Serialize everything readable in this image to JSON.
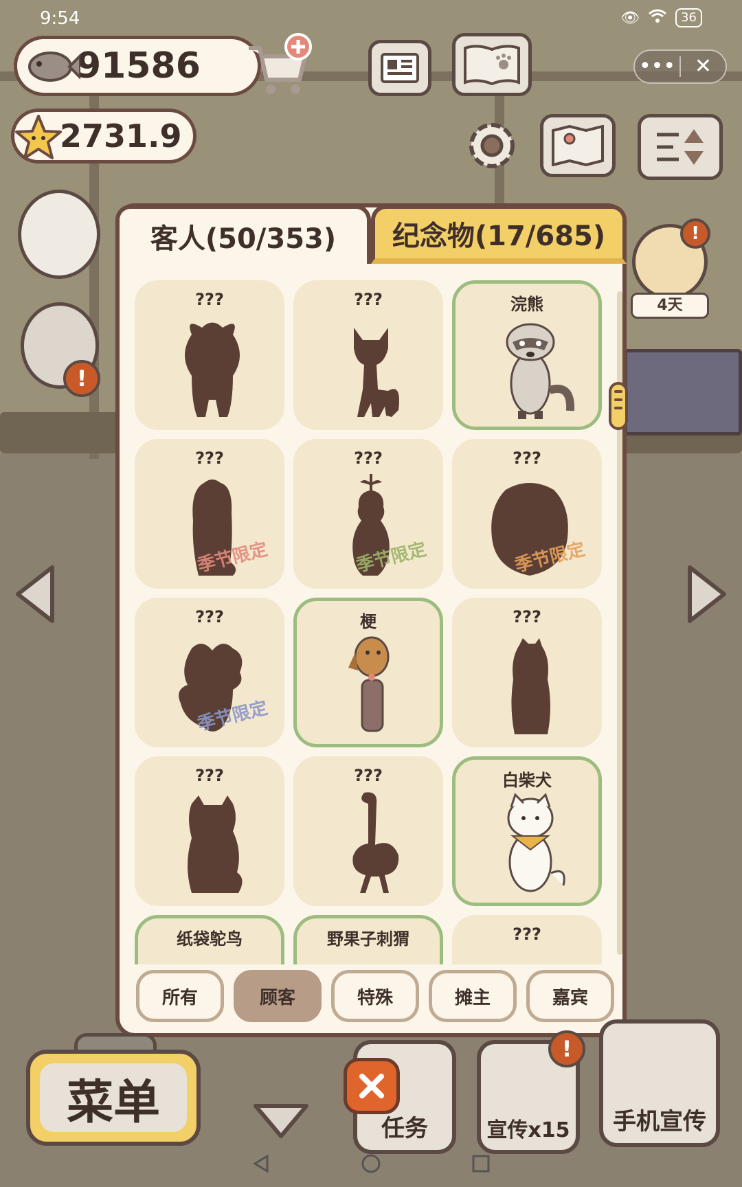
{
  "status_bar": {
    "time": "9:54",
    "battery": "36"
  },
  "currency": {
    "fish": "91586",
    "stars": "2731.9"
  },
  "customer_timer": "4天",
  "tabs": [
    {
      "label": "客人(50/353)",
      "active": true
    },
    {
      "label": "纪念物(17/685)",
      "active": false
    }
  ],
  "cards": [
    {
      "name": "???",
      "found": false,
      "shape": "fluffy",
      "badge": ""
    },
    {
      "name": "???",
      "found": false,
      "shape": "fox",
      "badge": ""
    },
    {
      "name": "浣熊",
      "found": true,
      "shape": "raccoon",
      "badge": ""
    },
    {
      "name": "???",
      "found": false,
      "shape": "tall",
      "badge": "季节限定",
      "badge_color": "#e3897c"
    },
    {
      "name": "???",
      "found": false,
      "shape": "sprout",
      "badge": "季节限定",
      "badge_color": "#9db36a"
    },
    {
      "name": "???",
      "found": false,
      "shape": "round",
      "badge": "季节限定",
      "badge_color": "#e6a05a"
    },
    {
      "name": "???",
      "found": false,
      "shape": "bush",
      "badge": "季节限定",
      "badge_color": "#8a97c9"
    },
    {
      "name": "梗",
      "found": true,
      "shape": "terrier",
      "badge": ""
    },
    {
      "name": "???",
      "found": false,
      "shape": "bear",
      "badge": ""
    },
    {
      "name": "???",
      "found": false,
      "shape": "cat",
      "badge": ""
    },
    {
      "name": "???",
      "found": false,
      "shape": "ostrich",
      "badge": ""
    },
    {
      "name": "白柴犬",
      "found": true,
      "shape": "shiba",
      "badge": ""
    },
    {
      "name": "纸袋鸵鸟",
      "found": true,
      "shape": "partial",
      "badge": ""
    },
    {
      "name": "野果子刺猬",
      "found": true,
      "shape": "partial",
      "badge": ""
    },
    {
      "name": "???",
      "found": false,
      "shape": "partial-dark",
      "badge": ""
    }
  ],
  "filters": [
    {
      "label": "所有",
      "active": false
    },
    {
      "label": "顾客",
      "active": true
    },
    {
      "label": "特殊",
      "active": false
    },
    {
      "label": "摊主",
      "active": false
    },
    {
      "label": "嘉宾",
      "active": false
    }
  ],
  "bottom": {
    "menu": "菜单",
    "tasks": "任务",
    "promo_count": "宣传x15",
    "phone_promo": "手机宣传"
  },
  "colors": {
    "silhouette": "#5b3f35",
    "found_border": "#9dbd80",
    "card_bg": "#f3e8cd",
    "accent_yellow": "#f3cf67"
  }
}
